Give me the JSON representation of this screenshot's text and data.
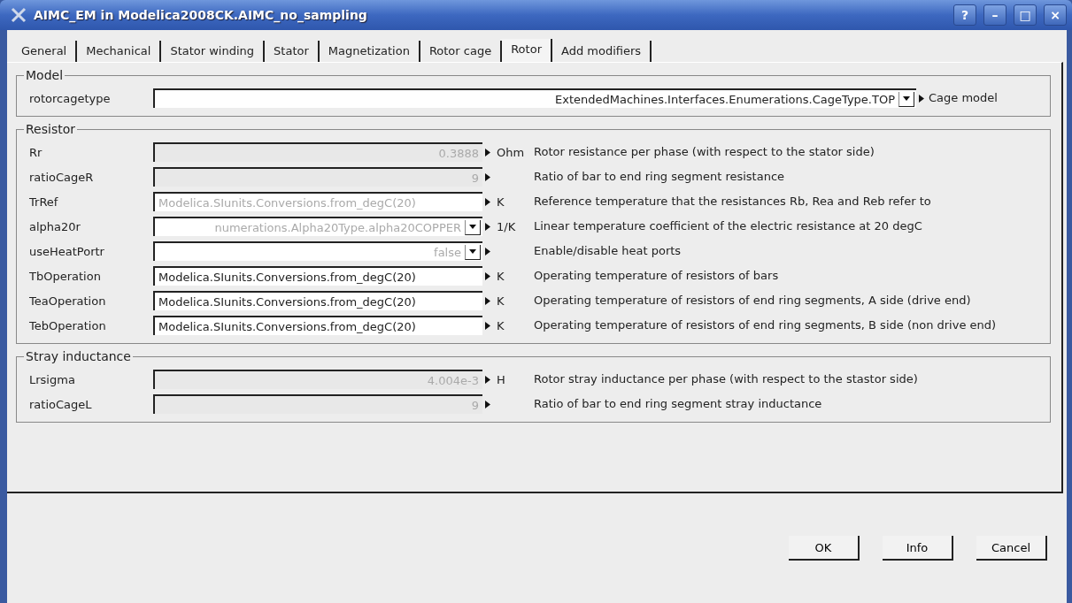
{
  "window": {
    "title": "AIMC_EM in Modelica2008CK.AIMC_no_sampling",
    "buttons": [
      "?",
      "–",
      "□",
      "×"
    ]
  },
  "tabs": [
    {
      "label": "General",
      "selected": false
    },
    {
      "label": "Mechanical",
      "selected": false
    },
    {
      "label": "Stator winding",
      "selected": false
    },
    {
      "label": "Stator",
      "selected": false
    },
    {
      "label": "Magnetization",
      "selected": false
    },
    {
      "label": "Rotor cage",
      "selected": false
    },
    {
      "label": "Rotor",
      "selected": true
    },
    {
      "label": "Add modifiers",
      "selected": false
    }
  ],
  "groups": [
    {
      "title": "Model",
      "parameters": [
        {
          "name": "rotorcagetype",
          "kind": "choice",
          "value": "ExtendedMachines.Interfaces.Enumerations.CageType.TOP",
          "disabled": false,
          "description": "Cage model"
        }
      ]
    },
    {
      "title": "Resistor",
      "parameters": [
        {
          "name": "Rr",
          "kind": "number",
          "placeholder": "0.3888",
          "disabled": true,
          "unit": "Ohm",
          "description": "Rotor resistance per phase (with respect to the stator side)"
        },
        {
          "name": "ratioCageR",
          "kind": "number",
          "placeholder": "9",
          "disabled": true,
          "description": "Ratio of bar to end ring segment resistance"
        },
        {
          "name": "TrRef",
          "kind": "expression",
          "placeholder": "Modelica.SIunits.Conversions.from_degC(20)",
          "disabled": false,
          "unit": "K",
          "description": "Reference temperature that the resistances Rb, Rea and Reb refer to"
        },
        {
          "name": "alpha20r",
          "kind": "choice",
          "placeholder": "numerations.Alpha20Type.alpha20COPPER",
          "disabled": false,
          "unit": "1/K",
          "description": "Linear temperature coefficient of the electric resistance at 20 degC"
        },
        {
          "name": "useHeatPortr",
          "kind": "choice",
          "placeholder": "false",
          "disabled": false,
          "description": "Enable/disable heat ports"
        },
        {
          "name": "TbOperation",
          "kind": "expression",
          "value": "Modelica.SIunits.Conversions.from_degC(20)",
          "disabled": false,
          "unit": "K",
          "description": "Operating temperature of resistors of bars"
        },
        {
          "name": "TeaOperation",
          "kind": "expression",
          "value": "Modelica.SIunits.Conversions.from_degC(20)",
          "disabled": false,
          "unit": "K",
          "description": "Operating temperature of resistors of end ring segments, A side (drive end)"
        },
        {
          "name": "TebOperation",
          "kind": "expression",
          "value": "Modelica.SIunits.Conversions.from_degC(20)",
          "disabled": false,
          "unit": "K",
          "description": "Operating temperature of resistors of end ring segments, B side (non drive end)"
        }
      ]
    },
    {
      "title": "Stray inductance",
      "parameters": [
        {
          "name": "Lrsigma",
          "kind": "number",
          "placeholder": "4.004e-3",
          "disabled": true,
          "unit": "H",
          "description": "Rotor stray inductance per phase (with respect to the stastor side)"
        },
        {
          "name": "ratioCageL",
          "kind": "number",
          "placeholder": "9",
          "disabled": true,
          "description": "Ratio of bar to end ring segment stray inductance"
        }
      ]
    }
  ],
  "actions": [
    "OK",
    "Info",
    "Cancel"
  ]
}
